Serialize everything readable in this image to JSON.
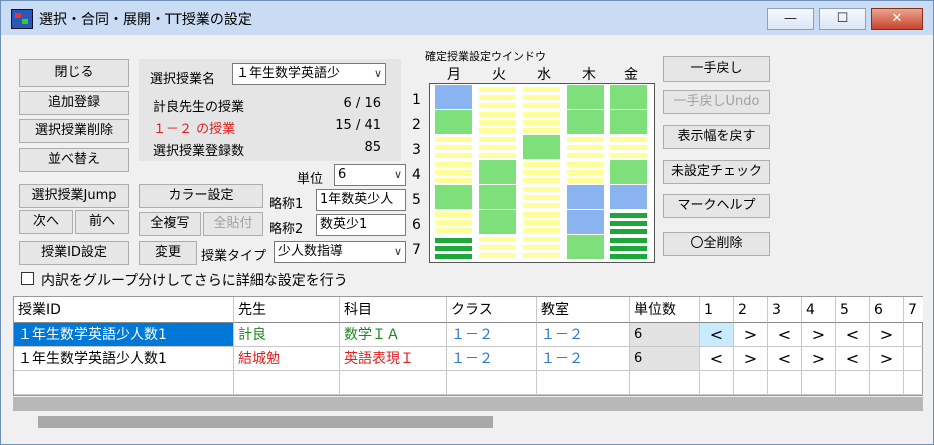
{
  "window": {
    "title": "選択・合同・展開・TT授業の設定",
    "controls": {
      "minimize": "—",
      "maximize": "☐",
      "close": "✕"
    }
  },
  "left_buttons": {
    "close": "閉じる",
    "add": "追加登録",
    "delete": "選択授業削除",
    "sort": "並べ替え",
    "jump": "選択授業Jump",
    "next": "次へ",
    "prev": "前へ",
    "id_setting": "授業ID設定"
  },
  "info": {
    "selected_label": "選択授業名",
    "selected_value": "１年生数学英語少",
    "teacher_label": "計良先生の授業",
    "teacher_value": "6 / 16",
    "class_label": "１－２ の授業",
    "class_value": "15 / 41",
    "count_label": "選択授業登録数",
    "count_value": "85"
  },
  "mid": {
    "color_button": "カラー設定",
    "copy_button": "全複写",
    "paste_button": "全貼付",
    "change_button": "変更",
    "unit_label": "単位",
    "unit_value": "6",
    "abbr1_label": "略称1",
    "abbr1_value": "1年数英少人",
    "abbr2_label": "略称2",
    "abbr2_value": "数英少1",
    "type_label": "授業タイプ",
    "type_value": "少人数指導"
  },
  "grid": {
    "caption": "確定授業設定ウインドウ",
    "days": [
      "月",
      "火",
      "水",
      "木",
      "金"
    ],
    "periods": [
      "1",
      "2",
      "3",
      "4",
      "5",
      "6",
      "7"
    ],
    "colors": {
      "blue": "#8ab4f0",
      "green": "#7ee07a",
      "yellow": "#ffff9a",
      "dgreen": "#1ea83a"
    }
  },
  "right_buttons": {
    "undo": "一手戻し",
    "undo_undo": "一手戻しUndo",
    "reset_width": "表示幅を戻す",
    "check": "未設定チェック",
    "mark_help": "マークヘルプ",
    "delete_all": "〇全削除"
  },
  "group_checkbox": "内訳をグループ分けしてさらに詳細な設定を行う",
  "table": {
    "headers": [
      "授業ID",
      "先生",
      "科目",
      "クラス",
      "教室",
      "単位数",
      "1",
      "2",
      "3",
      "4",
      "5",
      "6",
      "7"
    ],
    "rows": [
      {
        "id": "１年生数学英語少人数1",
        "teacher": "計良",
        "subject": "数学ＩＡ",
        "class": "１－２",
        "room": "１－２",
        "units": "6",
        "marks": [
          "<",
          ">",
          "<",
          ">",
          "<",
          ">"
        ]
      },
      {
        "id": "１年生数学英語少人数1",
        "teacher": "結城勉",
        "subject": "英語表現Ｉ",
        "class": "１－２",
        "room": "１－２",
        "units": "6",
        "marks": [
          "<",
          ">",
          "<",
          ">",
          "<",
          ">"
        ]
      }
    ]
  }
}
